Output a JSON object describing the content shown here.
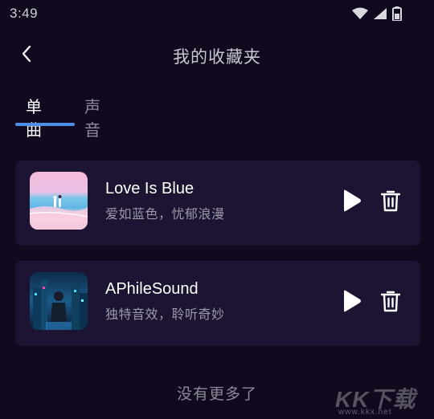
{
  "statusbar": {
    "time": "3:49",
    "icons": [
      "wifi-icon",
      "signal-icon",
      "battery-icon"
    ]
  },
  "header": {
    "back_icon": "chevron-left-icon",
    "title": "我的收藏夹"
  },
  "tabs": [
    {
      "label": "单曲",
      "active": true
    },
    {
      "label": "声音",
      "active": false
    }
  ],
  "songs": [
    {
      "title": "Love Is Blue",
      "subtitle": "爱如蓝色，忧郁浪漫",
      "cover": "beach-couple-image"
    },
    {
      "title": "APhileSound",
      "subtitle": "独特音效，聆听奇妙",
      "cover": "cyber-city-image"
    }
  ],
  "actions": {
    "play_icon": "play-icon",
    "delete_icon": "trash-icon"
  },
  "footer": {
    "text": "没有更多了"
  },
  "watermark": {
    "text": "KK下载",
    "url": "www.kkx.net"
  },
  "colors": {
    "background": "#110a1f",
    "card": "#1c1432",
    "accent": "#4a8fe8"
  }
}
